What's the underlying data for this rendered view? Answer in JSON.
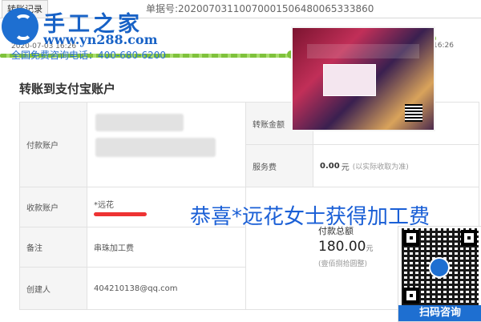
{
  "tab": {
    "label": "转账记录"
  },
  "order": {
    "label": "单据号:",
    "number": "20200703110070001506480065333860"
  },
  "brand": {
    "name": "手工之家",
    "site": "www.yn288.com",
    "hotline": "全国免费咨询电话：400-680-6200"
  },
  "timeline": {
    "start_time": "2020-07-03 16:26",
    "end_time": "16:26"
  },
  "section": {
    "title": "转账到支付宝账户"
  },
  "table": {
    "payer_label": "付款账户",
    "payee_label": "收款账户",
    "payee_name": "*远花",
    "note_label": "备注",
    "note_value": "串珠加工费",
    "creator_label": "创建人",
    "creator_value": "404210138@qq.com",
    "amount_label": "转账金额",
    "fee_label": "服务费",
    "fee_value": "0.00",
    "fee_unit": "元",
    "fee_note": "(以实际收取为准)",
    "total_label": "付款总额",
    "total_value": "180.00",
    "total_unit": "元",
    "total_capital": "壹佰捌拾圆整"
  },
  "banner": {
    "congrats": "恭喜*远花女士获得加工费"
  },
  "qr": {
    "label": "扫码咨询"
  },
  "colors": {
    "brand_blue": "#1862c6",
    "progress_green": "#7fc23c",
    "banner_blue": "#1a5fd6"
  }
}
